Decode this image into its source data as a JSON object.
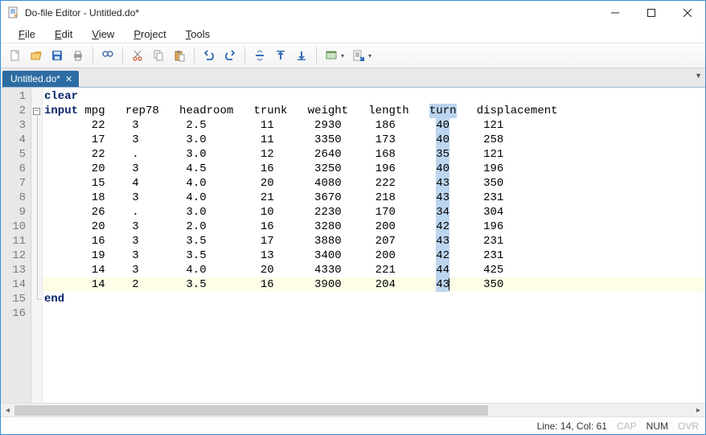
{
  "window": {
    "title": "Do-file Editor - Untitled.do*"
  },
  "menubar": [
    {
      "label": "File",
      "accel": "F"
    },
    {
      "label": "Edit",
      "accel": "E"
    },
    {
      "label": "View",
      "accel": "V"
    },
    {
      "label": "Project",
      "accel": "P"
    },
    {
      "label": "Tools",
      "accel": "T"
    }
  ],
  "tab": {
    "label": "Untitled.do*"
  },
  "code": {
    "keywords": {
      "clear": "clear",
      "input": "input",
      "end": "end"
    },
    "header_left": " mpg   rep78   headroom   trunk   weight   length   ",
    "header_sel": "turn",
    "header_right": "   displacement",
    "rows": [
      {
        "left": "      22    3       2.5        11      2930     186      ",
        "sel": "40",
        "right": "     121"
      },
      {
        "left": "      17    3       3.0        11      3350     173      ",
        "sel": "40",
        "right": "     258"
      },
      {
        "left": "      22    .       3.0        12      2640     168      ",
        "sel": "35",
        "right": "     121"
      },
      {
        "left": "      20    3       4.5        16      3250     196      ",
        "sel": "40",
        "right": "     196"
      },
      {
        "left": "      15    4       4.0        20      4080     222      ",
        "sel": "43",
        "right": "     350"
      },
      {
        "left": "      18    3       4.0        21      3670     218      ",
        "sel": "43",
        "right": "     231"
      },
      {
        "left": "      26    .       3.0        10      2230     170      ",
        "sel": "34",
        "right": "     304"
      },
      {
        "left": "      20    3       2.0        16      3280     200      ",
        "sel": "42",
        "right": "     196"
      },
      {
        "left": "      16    3       3.5        17      3880     207      ",
        "sel": "43",
        "right": "     231"
      },
      {
        "left": "      19    3       3.5        13      3400     200      ",
        "sel": "42",
        "right": "     231"
      },
      {
        "left": "      14    3       4.0        20      4330     221      ",
        "sel": "44",
        "right": "     425"
      },
      {
        "left": "      14    2       3.5        16      3900     204      ",
        "sel": "43",
        "right": "     350"
      }
    ],
    "line_count": 16,
    "current_line": 14
  },
  "status": {
    "pos": "Line: 14, Col: 61",
    "cap": "CAP",
    "num": "NUM",
    "ovr": "OVR"
  },
  "chart_data": {
    "type": "table",
    "title": "Stata input data",
    "columns": [
      "mpg",
      "rep78",
      "headroom",
      "trunk",
      "weight",
      "length",
      "turn",
      "displacement"
    ],
    "rows": [
      [
        22,
        3,
        2.5,
        11,
        2930,
        186,
        40,
        121
      ],
      [
        17,
        3,
        3.0,
        11,
        3350,
        173,
        40,
        258
      ],
      [
        22,
        null,
        3.0,
        12,
        2640,
        168,
        35,
        121
      ],
      [
        20,
        3,
        4.5,
        16,
        3250,
        196,
        40,
        196
      ],
      [
        15,
        4,
        4.0,
        20,
        4080,
        222,
        43,
        350
      ],
      [
        18,
        3,
        4.0,
        21,
        3670,
        218,
        43,
        231
      ],
      [
        26,
        null,
        3.0,
        10,
        2230,
        170,
        34,
        304
      ],
      [
        20,
        3,
        2.0,
        16,
        3280,
        200,
        42,
        196
      ],
      [
        16,
        3,
        3.5,
        17,
        3880,
        207,
        43,
        231
      ],
      [
        19,
        3,
        3.5,
        13,
        3400,
        200,
        42,
        231
      ],
      [
        14,
        3,
        4.0,
        20,
        4330,
        221,
        44,
        425
      ],
      [
        14,
        2,
        3.5,
        16,
        3900,
        204,
        43,
        350
      ]
    ]
  }
}
